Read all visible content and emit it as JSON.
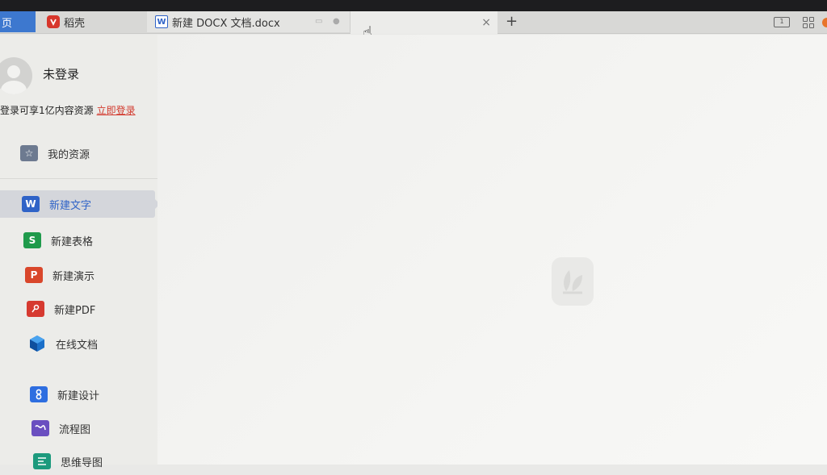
{
  "tabs": {
    "home_label": "页",
    "daoke_label": "稻壳",
    "doc_label": "新建 DOCX 文档.docx",
    "new_tab_symbol": "+",
    "close_symbol": "×"
  },
  "window_controls": {
    "layout_icon_text": "1"
  },
  "user": {
    "name": "未登录",
    "login_tip": "登录可享1亿内容资源",
    "login_link": "立即登录"
  },
  "sidebar": {
    "resources_label": "我的资源",
    "items": [
      {
        "label": "新建文字",
        "icon": "W",
        "color": "#2f63c7"
      },
      {
        "label": "新建表格",
        "icon": "S",
        "color": "#1f9a4b"
      },
      {
        "label": "新建演示",
        "icon": "P",
        "color": "#d9472b"
      },
      {
        "label": "新建PDF",
        "icon": "P",
        "color": "#d63a30"
      },
      {
        "label": "在线文档",
        "icon": "◆",
        "color": "#1b6fc9"
      },
      {
        "label": "新建设计",
        "icon": "8",
        "color": "#2e6ee0"
      },
      {
        "label": "流程图",
        "icon": "≈",
        "color": "#6a4fc0"
      },
      {
        "label": "思维导图",
        "icon": "≡",
        "color": "#1c9a7d"
      }
    ]
  },
  "colors": {
    "accent": "#2f63c7",
    "brand_red": "#d7362b",
    "link_red": "#d23a2e"
  }
}
